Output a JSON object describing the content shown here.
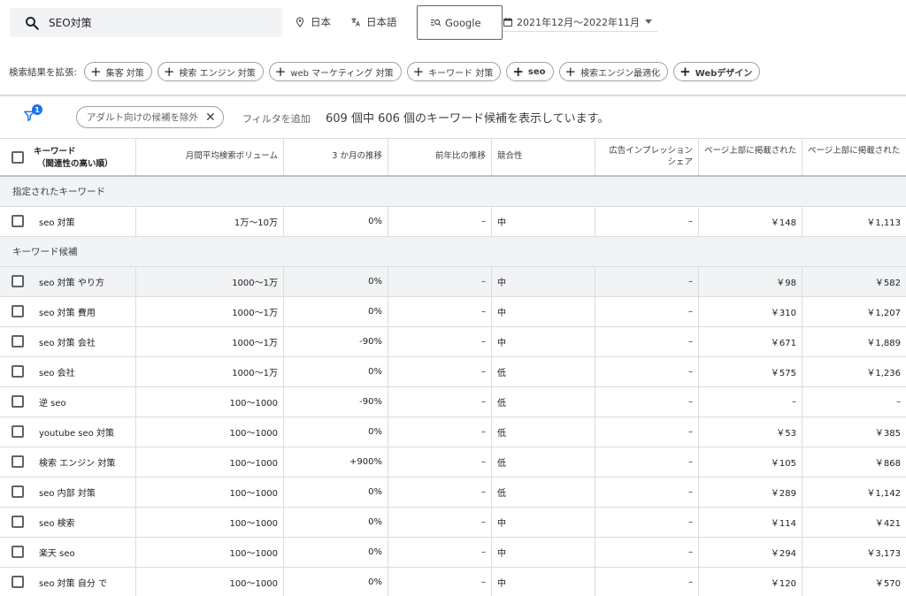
{
  "header": {
    "search_value": "SEO対策",
    "location": "日本",
    "language": "日本語",
    "network": "Google",
    "date_range": "2021年12月〜2022年11月"
  },
  "expand": {
    "label": "検索結果を拡張:",
    "chips": [
      "集客 対策",
      "検索 エンジン 対策",
      "web マーケティング 対策",
      "キーワード 対策",
      "seo",
      "検索エンジン最適化",
      "Webデザイン"
    ]
  },
  "filter": {
    "badge": "1",
    "adult_chip": "アダルト向けの候補を除外",
    "add_filter": "フィルタを追加",
    "count_text": "609 個中 606 個のキーワード候補を表示しています。"
  },
  "table": {
    "headers": {
      "keyword_line1": "キーワード",
      "keyword_line2": "（関連性の高い順）",
      "volume": "月間平均検索ボリューム",
      "trend3m": "3 か月の推移",
      "yoy": "前年比の推移",
      "competition": "競合性",
      "impression_line1": "広告インプレッション",
      "impression_line2": "シェア",
      "bid_low": "ページ上部に掲載された広告の入札単価（低額帯）",
      "bid_high": "ページ上部に掲載された広告の入札単価（高額帯）"
    },
    "section_specified": "指定されたキーワード",
    "section_candidates": "キーワード候補",
    "specified_rows": [
      {
        "keyword": "seo 対策",
        "volume": "1万〜10万",
        "trend3m": "0%",
        "yoy": "–",
        "competition": "中",
        "impression": "–",
        "bid_low": "￥148",
        "bid_high": "￥1,113"
      }
    ],
    "candidate_rows": [
      {
        "keyword": "seo 対策 やり方",
        "volume": "1000〜1万",
        "trend3m": "0%",
        "yoy": "–",
        "competition": "中",
        "impression": "–",
        "bid_low": "￥98",
        "bid_high": "￥582"
      },
      {
        "keyword": "seo 対策 費用",
        "volume": "1000〜1万",
        "trend3m": "0%",
        "yoy": "–",
        "competition": "中",
        "impression": "–",
        "bid_low": "￥310",
        "bid_high": "￥1,207"
      },
      {
        "keyword": "seo 対策 会社",
        "volume": "1000〜1万",
        "trend3m": "-90%",
        "yoy": "–",
        "competition": "中",
        "impression": "–",
        "bid_low": "￥671",
        "bid_high": "￥1,889"
      },
      {
        "keyword": "seo 会社",
        "volume": "1000〜1万",
        "trend3m": "0%",
        "yoy": "–",
        "competition": "低",
        "impression": "–",
        "bid_low": "￥575",
        "bid_high": "￥1,236"
      },
      {
        "keyword": "逆 seo",
        "volume": "100〜1000",
        "trend3m": "-90%",
        "yoy": "–",
        "competition": "低",
        "impression": "–",
        "bid_low": "–",
        "bid_high": "–"
      },
      {
        "keyword": "youtube seo 対策",
        "volume": "100〜1000",
        "trend3m": "0%",
        "yoy": "–",
        "competition": "低",
        "impression": "–",
        "bid_low": "￥53",
        "bid_high": "￥385"
      },
      {
        "keyword": "検索 エンジン 対策",
        "volume": "100〜1000",
        "trend3m": "+900%",
        "yoy": "–",
        "competition": "低",
        "impression": "–",
        "bid_low": "￥105",
        "bid_high": "￥868"
      },
      {
        "keyword": "seo 内部 対策",
        "volume": "100〜1000",
        "trend3m": "0%",
        "yoy": "–",
        "competition": "低",
        "impression": "–",
        "bid_low": "￥289",
        "bid_high": "￥1,142"
      },
      {
        "keyword": "seo 検索",
        "volume": "100〜1000",
        "trend3m": "0%",
        "yoy": "–",
        "competition": "中",
        "impression": "–",
        "bid_low": "￥114",
        "bid_high": "￥421"
      },
      {
        "keyword": "楽天 seo",
        "volume": "100〜1000",
        "trend3m": "0%",
        "yoy": "–",
        "competition": "中",
        "impression": "–",
        "bid_low": "￥294",
        "bid_high": "￥3,173"
      },
      {
        "keyword": "seo 対策 自分 で",
        "volume": "100〜1000",
        "trend3m": "0%",
        "yoy": "–",
        "competition": "中",
        "impression": "–",
        "bid_low": "￥120",
        "bid_high": "￥570"
      }
    ]
  }
}
